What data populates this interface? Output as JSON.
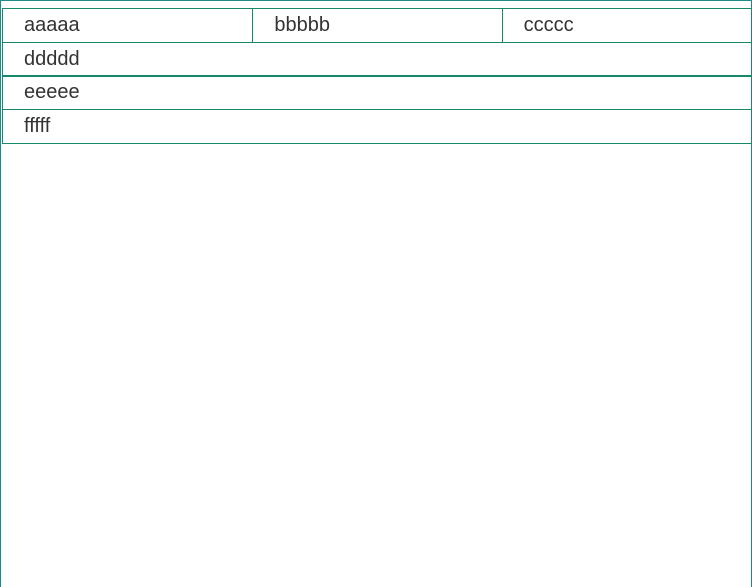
{
  "rows": [
    {
      "cells": [
        "aaaaa",
        "bbbbb",
        "ccccc"
      ]
    },
    {
      "cells": [
        "ddddd"
      ]
    },
    {
      "cells": [
        "eeeee"
      ]
    },
    {
      "cells": [
        "fffff"
      ]
    }
  ],
  "colors": {
    "border": "#16896b",
    "text": "#333333",
    "frame": "#1f8a8a"
  }
}
